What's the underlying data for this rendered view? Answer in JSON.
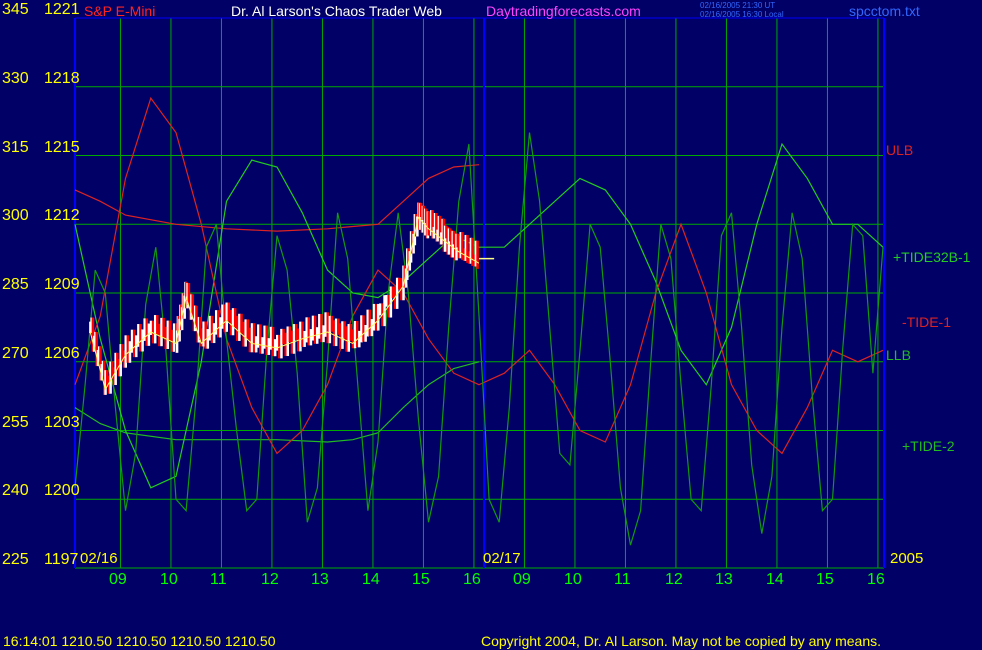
{
  "header": {
    "symbol": "S&P E-Mini",
    "title": "Dr. Al Larson's Chaos Trader Web",
    "site": "Daytradingforecasts.com",
    "time_ut": "02/16/2005 21:30 UT",
    "time_local": "02/16/2005 16:30 Local",
    "filename": "spcctom.txt"
  },
  "footer": {
    "quote": "16:14:01  1210.50  1210.50  1210.50  1210.50",
    "copyright": "Copyright 2004, Dr. Al Larson. May not be copied by any means."
  },
  "colors": {
    "background": "#000066",
    "grid": "#00aa00",
    "axis": "#0000ff",
    "price_up": "#ffffff",
    "price_down": "#ff0000",
    "ulb": "#dd2222",
    "llb": "#22bb22",
    "tide32b": "#22cc22",
    "tide1": "#dd2222",
    "tide2": "#119911",
    "yellow_text": "#ffff00",
    "green_text": "#00ff00"
  },
  "chart_data": {
    "type": "line",
    "y_left_outer": [
      "345",
      "330",
      "315",
      "300",
      "285",
      "270",
      "255",
      "240",
      "225"
    ],
    "y_left_inner": [
      "1221",
      "1218",
      "1215",
      "1212",
      "1209",
      "1206",
      "1203",
      "1200",
      "1197"
    ],
    "ylim": [
      1197,
      1221
    ],
    "x_hours": [
      9,
      10,
      11,
      12,
      13,
      14,
      15,
      16,
      9,
      10,
      11,
      12,
      13,
      14,
      15,
      16
    ],
    "x_tick_labels": [
      "09",
      "10",
      "11",
      "12",
      "13",
      "14",
      "15",
      "16",
      "09",
      "10",
      "11",
      "12",
      "13",
      "14",
      "15",
      "16"
    ],
    "date_labels": [
      "02/16",
      "02/17"
    ],
    "year_label": "2005",
    "last_price": 1210.5,
    "series_labels": {
      "ulb": "ULB",
      "tide32b": "+TIDE32B-1",
      "tide1": "-TIDE-1",
      "llb": "LLB",
      "tide2": "+TIDE-2"
    },
    "price_bars_day1": {
      "x": [
        8.3,
        8.6,
        9.0,
        9.5,
        10.0,
        10.2,
        10.5,
        11.0,
        11.5,
        12.0,
        12.5,
        13.0,
        13.5,
        14.0,
        14.5,
        14.8,
        15.0,
        15.3,
        15.6,
        16.0
      ],
      "close": [
        1207.5,
        1205.0,
        1206.5,
        1207.5,
        1207.0,
        1209.0,
        1207.0,
        1208.0,
        1207.0,
        1206.8,
        1207.2,
        1207.5,
        1207.0,
        1208.0,
        1209.5,
        1212.5,
        1212.0,
        1211.5,
        1211.0,
        1210.5
      ]
    },
    "series": [
      {
        "id": "ulb",
        "x": [
          8.0,
          8.5,
          9.0,
          10.0,
          11.0,
          12.0,
          13.0,
          13.5,
          14.0,
          14.5,
          15.0,
          15.5,
          16.0
        ],
        "y": [
          1213.5,
          1213.0,
          1212.4,
          1212.0,
          1211.8,
          1211.7,
          1211.8,
          1211.9,
          1212.0,
          1213.0,
          1214.0,
          1214.5,
          1214.6
        ]
      },
      {
        "id": "llb",
        "x": [
          8.0,
          8.5,
          9.0,
          10.0,
          11.0,
          12.0,
          13.0,
          13.5,
          14.0,
          14.5,
          15.0,
          15.5,
          16.0
        ],
        "y": [
          1204.0,
          1203.3,
          1202.9,
          1202.6,
          1202.6,
          1202.6,
          1202.5,
          1202.6,
          1202.9,
          1204.0,
          1205.0,
          1205.7,
          1206.0
        ]
      },
      {
        "id": "tide32b",
        "x": [
          8.0,
          8.5,
          9.0,
          9.5,
          10.0,
          10.5,
          11.0,
          11.5,
          12.0,
          12.5,
          13.0,
          13.5,
          14.0,
          14.5,
          15.0,
          15.5,
          16.0,
          16.5,
          17.0,
          17.5,
          18.0,
          18.5,
          19.0,
          19.5,
          20.0,
          20.5,
          21.0,
          21.5,
          22.0,
          22.5,
          23.0,
          23.5,
          24.0
        ],
        "y": [
          1212.0,
          1207.0,
          1203.0,
          1200.5,
          1201.0,
          1206.0,
          1213.0,
          1214.8,
          1214.5,
          1212.5,
          1210.0,
          1209.0,
          1208.8,
          1209.5,
          1210.5,
          1211.5,
          1211.0,
          1211.0,
          1212.0,
          1213.0,
          1214.0,
          1213.5,
          1212.0,
          1209.5,
          1206.5,
          1205.0,
          1207.5,
          1212.0,
          1215.5,
          1214.0,
          1212.0,
          1212.0,
          1211.0
        ]
      },
      {
        "id": "tide1",
        "x": [
          8.0,
          8.5,
          9.0,
          9.5,
          10.0,
          10.5,
          11.0,
          11.5,
          12.0,
          12.5,
          13.0,
          13.5,
          14.0,
          14.5,
          15.0,
          15.5,
          16.0,
          16.5,
          17.0,
          17.5,
          18.0,
          18.5,
          19.0,
          19.5,
          20.0,
          20.5,
          21.0,
          21.5,
          22.0,
          22.5,
          23.0,
          23.5,
          24.0
        ],
        "y": [
          1205.0,
          1208.0,
          1214.0,
          1217.5,
          1216.0,
          1212.0,
          1207.0,
          1204.0,
          1202.0,
          1203.0,
          1205.0,
          1208.0,
          1210.0,
          1209.0,
          1207.0,
          1205.5,
          1205.0,
          1205.5,
          1206.5,
          1205.0,
          1203.0,
          1202.5,
          1205.0,
          1209.0,
          1212.0,
          1209.0,
          1205.0,
          1203.0,
          1202.0,
          1204.0,
          1206.5,
          1206.0,
          1206.5
        ]
      },
      {
        "id": "tide2",
        "x": [
          8.0,
          8.2,
          8.4,
          8.6,
          8.8,
          9.0,
          9.2,
          9.4,
          9.6,
          9.8,
          10.0,
          10.2,
          10.4,
          10.6,
          10.8,
          11.0,
          11.2,
          11.4,
          11.6,
          11.8,
          12.0,
          12.2,
          12.4,
          12.6,
          12.8,
          13.0,
          13.2,
          13.4,
          13.6,
          13.8,
          14.0,
          14.2,
          14.4,
          14.6,
          14.8,
          15.0,
          15.2,
          15.4,
          15.6,
          15.8,
          16.0,
          16.2,
          16.4,
          16.6,
          16.8,
          17.0,
          17.2,
          17.4,
          17.6,
          17.8,
          18.0,
          18.2,
          18.4,
          18.6,
          18.8,
          19.0,
          19.2,
          19.4,
          19.6,
          19.8,
          20.0,
          20.2,
          20.4,
          20.6,
          20.8,
          21.0,
          21.2,
          21.4,
          21.6,
          21.8,
          22.0,
          22.2,
          22.4,
          22.6,
          22.8,
          23.0,
          23.2,
          23.4,
          23.6,
          23.8,
          24.0
        ],
        "y": [
          1200.5,
          1205.0,
          1210.0,
          1209.0,
          1204.0,
          1199.5,
          1202.0,
          1208.5,
          1211.0,
          1206.5,
          1200.0,
          1199.5,
          1204.5,
          1211.0,
          1212.0,
          1207.0,
          1203.0,
          1199.5,
          1200.0,
          1206.5,
          1211.5,
          1210.0,
          1205.5,
          1199.0,
          1200.5,
          1206.0,
          1212.5,
          1210.5,
          1205.0,
          1199.5,
          1202.5,
          1209.0,
          1212.5,
          1209.0,
          1203.5,
          1199.0,
          1201.0,
          1207.5,
          1213.0,
          1215.5,
          1208.0,
          1200.0,
          1199.0,
          1204.0,
          1211.0,
          1216.0,
          1213.0,
          1207.5,
          1202.0,
          1201.5,
          1206.5,
          1212.0,
          1211.0,
          1206.0,
          1200.5,
          1198.0,
          1199.5,
          1206.0,
          1212.0,
          1210.5,
          1205.0,
          1200.0,
          1199.5,
          1205.0,
          1211.5,
          1212.5,
          1207.5,
          1201.5,
          1198.5,
          1201.0,
          1207.5,
          1212.5,
          1210.5,
          1204.5,
          1199.5,
          1200.0,
          1206.5,
          1212.0,
          1211.5,
          1205.5,
          1211.0
        ]
      }
    ]
  }
}
